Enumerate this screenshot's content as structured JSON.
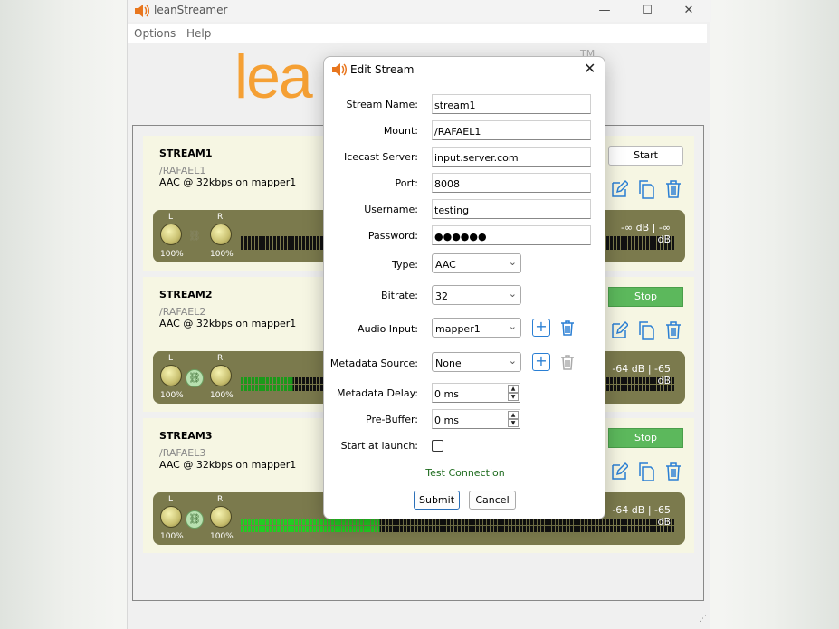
{
  "app": {
    "title": "leanStreamer",
    "logo_text": "lea",
    "tm": "TM"
  },
  "menu": [
    "Options",
    "Help"
  ],
  "window_controls": {
    "minimize": "—",
    "maximize": "☐",
    "close": "✕"
  },
  "streams": [
    {
      "name": "STREAM1",
      "mount": "/RAFAEL1",
      "desc": "AAC @ 32kbps on mapper1",
      "button": "Start",
      "db": "-∞ dB | -∞ dB",
      "left_label": "L",
      "right_label": "R",
      "left_pct": "100%",
      "right_pct": "100%",
      "level": 0
    },
    {
      "name": "STREAM2",
      "mount": "/RAFAEL2",
      "desc": "AAC @ 32kbps on mapper1",
      "button": "Stop",
      "db": "-64 dB | -65 dB",
      "left_label": "L",
      "right_label": "R",
      "left_pct": "100%",
      "right_pct": "100%",
      "level": 0.0
    },
    {
      "name": "STREAM3",
      "mount": "/RAFAEL3",
      "desc": "AAC @ 32kbps on mapper1",
      "button": "Stop",
      "db": "-64 dB | -65 dB",
      "left_label": "L",
      "right_label": "R",
      "left_pct": "100%",
      "right_pct": "100%",
      "level": 0.32
    }
  ],
  "dialog": {
    "title": "Edit Stream",
    "close": "✕",
    "fields": {
      "stream_name": {
        "label": "Stream Name:",
        "value": "stream1"
      },
      "mount": {
        "label": "Mount:",
        "value": "/RAFAEL1"
      },
      "server": {
        "label": "Icecast Server:",
        "value": "input.server.com"
      },
      "port": {
        "label": "Port:",
        "value": "8008"
      },
      "username": {
        "label": "Username:",
        "value": "testing"
      },
      "password": {
        "label": "Password:",
        "value": "●●●●●●"
      },
      "type": {
        "label": "Type:",
        "value": "AAC"
      },
      "bitrate": {
        "label": "Bitrate:",
        "value": "32"
      },
      "audio_input": {
        "label": "Audio Input:",
        "value": "mapper1"
      },
      "metadata_source": {
        "label": "Metadata Source:",
        "value": "None"
      },
      "metadata_delay": {
        "label": "Metadata Delay:",
        "value": "0 ms"
      },
      "pre_buffer": {
        "label": "Pre-Buffer:",
        "value": "0 ms"
      },
      "start_at_launch": {
        "label": "Start at launch:",
        "checked": false
      }
    },
    "test_connection": "Test Connection",
    "submit": "Submit",
    "cancel": "Cancel"
  },
  "colors": {
    "accent": "#2a7fd4",
    "logo": "#f5a034",
    "stop": "#5cb85c",
    "meter_bg": "#7b7a4d",
    "level_green": "#22cc22"
  }
}
